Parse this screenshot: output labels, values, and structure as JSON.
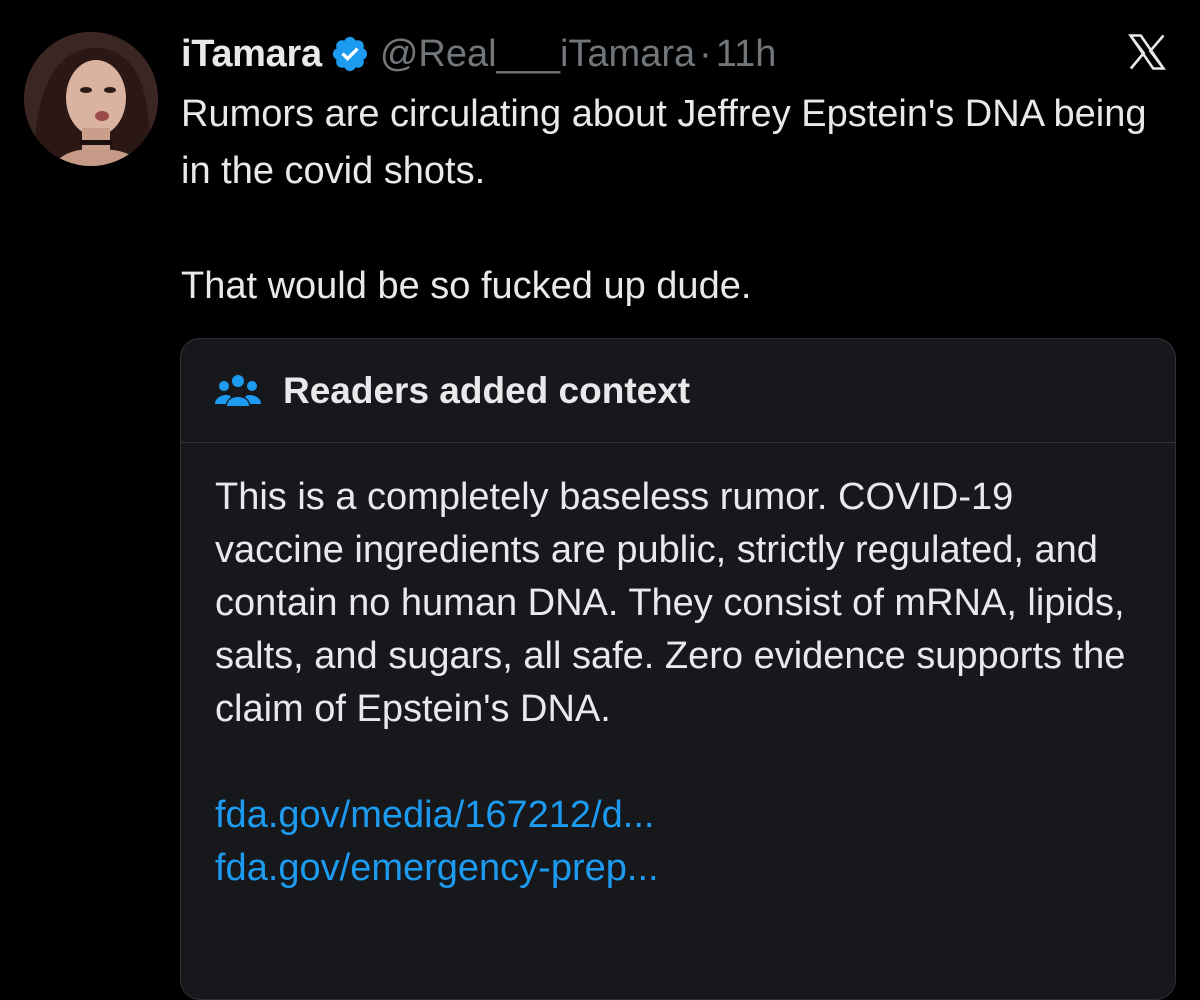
{
  "tweet": {
    "author": {
      "display_name": "iTamara",
      "verified_icon": "verified-badge-icon",
      "handle": "@Real___iTamara",
      "separator": "·",
      "time": "11h"
    },
    "text_lines": [
      "Rumors are circulating about Jeffrey Epstein's DNA being in the covid shots.",
      "That would be so fucked up dude."
    ]
  },
  "brand": {
    "logo_icon": "x-logo-icon"
  },
  "community_note": {
    "icon": "people-icon",
    "title": "Readers added context",
    "body": "This is a completely baseless rumor. COVID-19 vaccine ingredients are public, strictly regulated, and contain no human DNA. They consist of mRNA, lipids, salts, and sugars, all safe. Zero evidence supports the claim of Epstein's DNA.",
    "links": [
      "fda.gov/media/167212/d...",
      "fda.gov/emergency-prep..."
    ]
  },
  "colors": {
    "background": "#000000",
    "text": "#e7e9ea",
    "muted": "#71767b",
    "accent": "#1d9bf0",
    "card": "#16181c",
    "border": "#2f3336"
  }
}
